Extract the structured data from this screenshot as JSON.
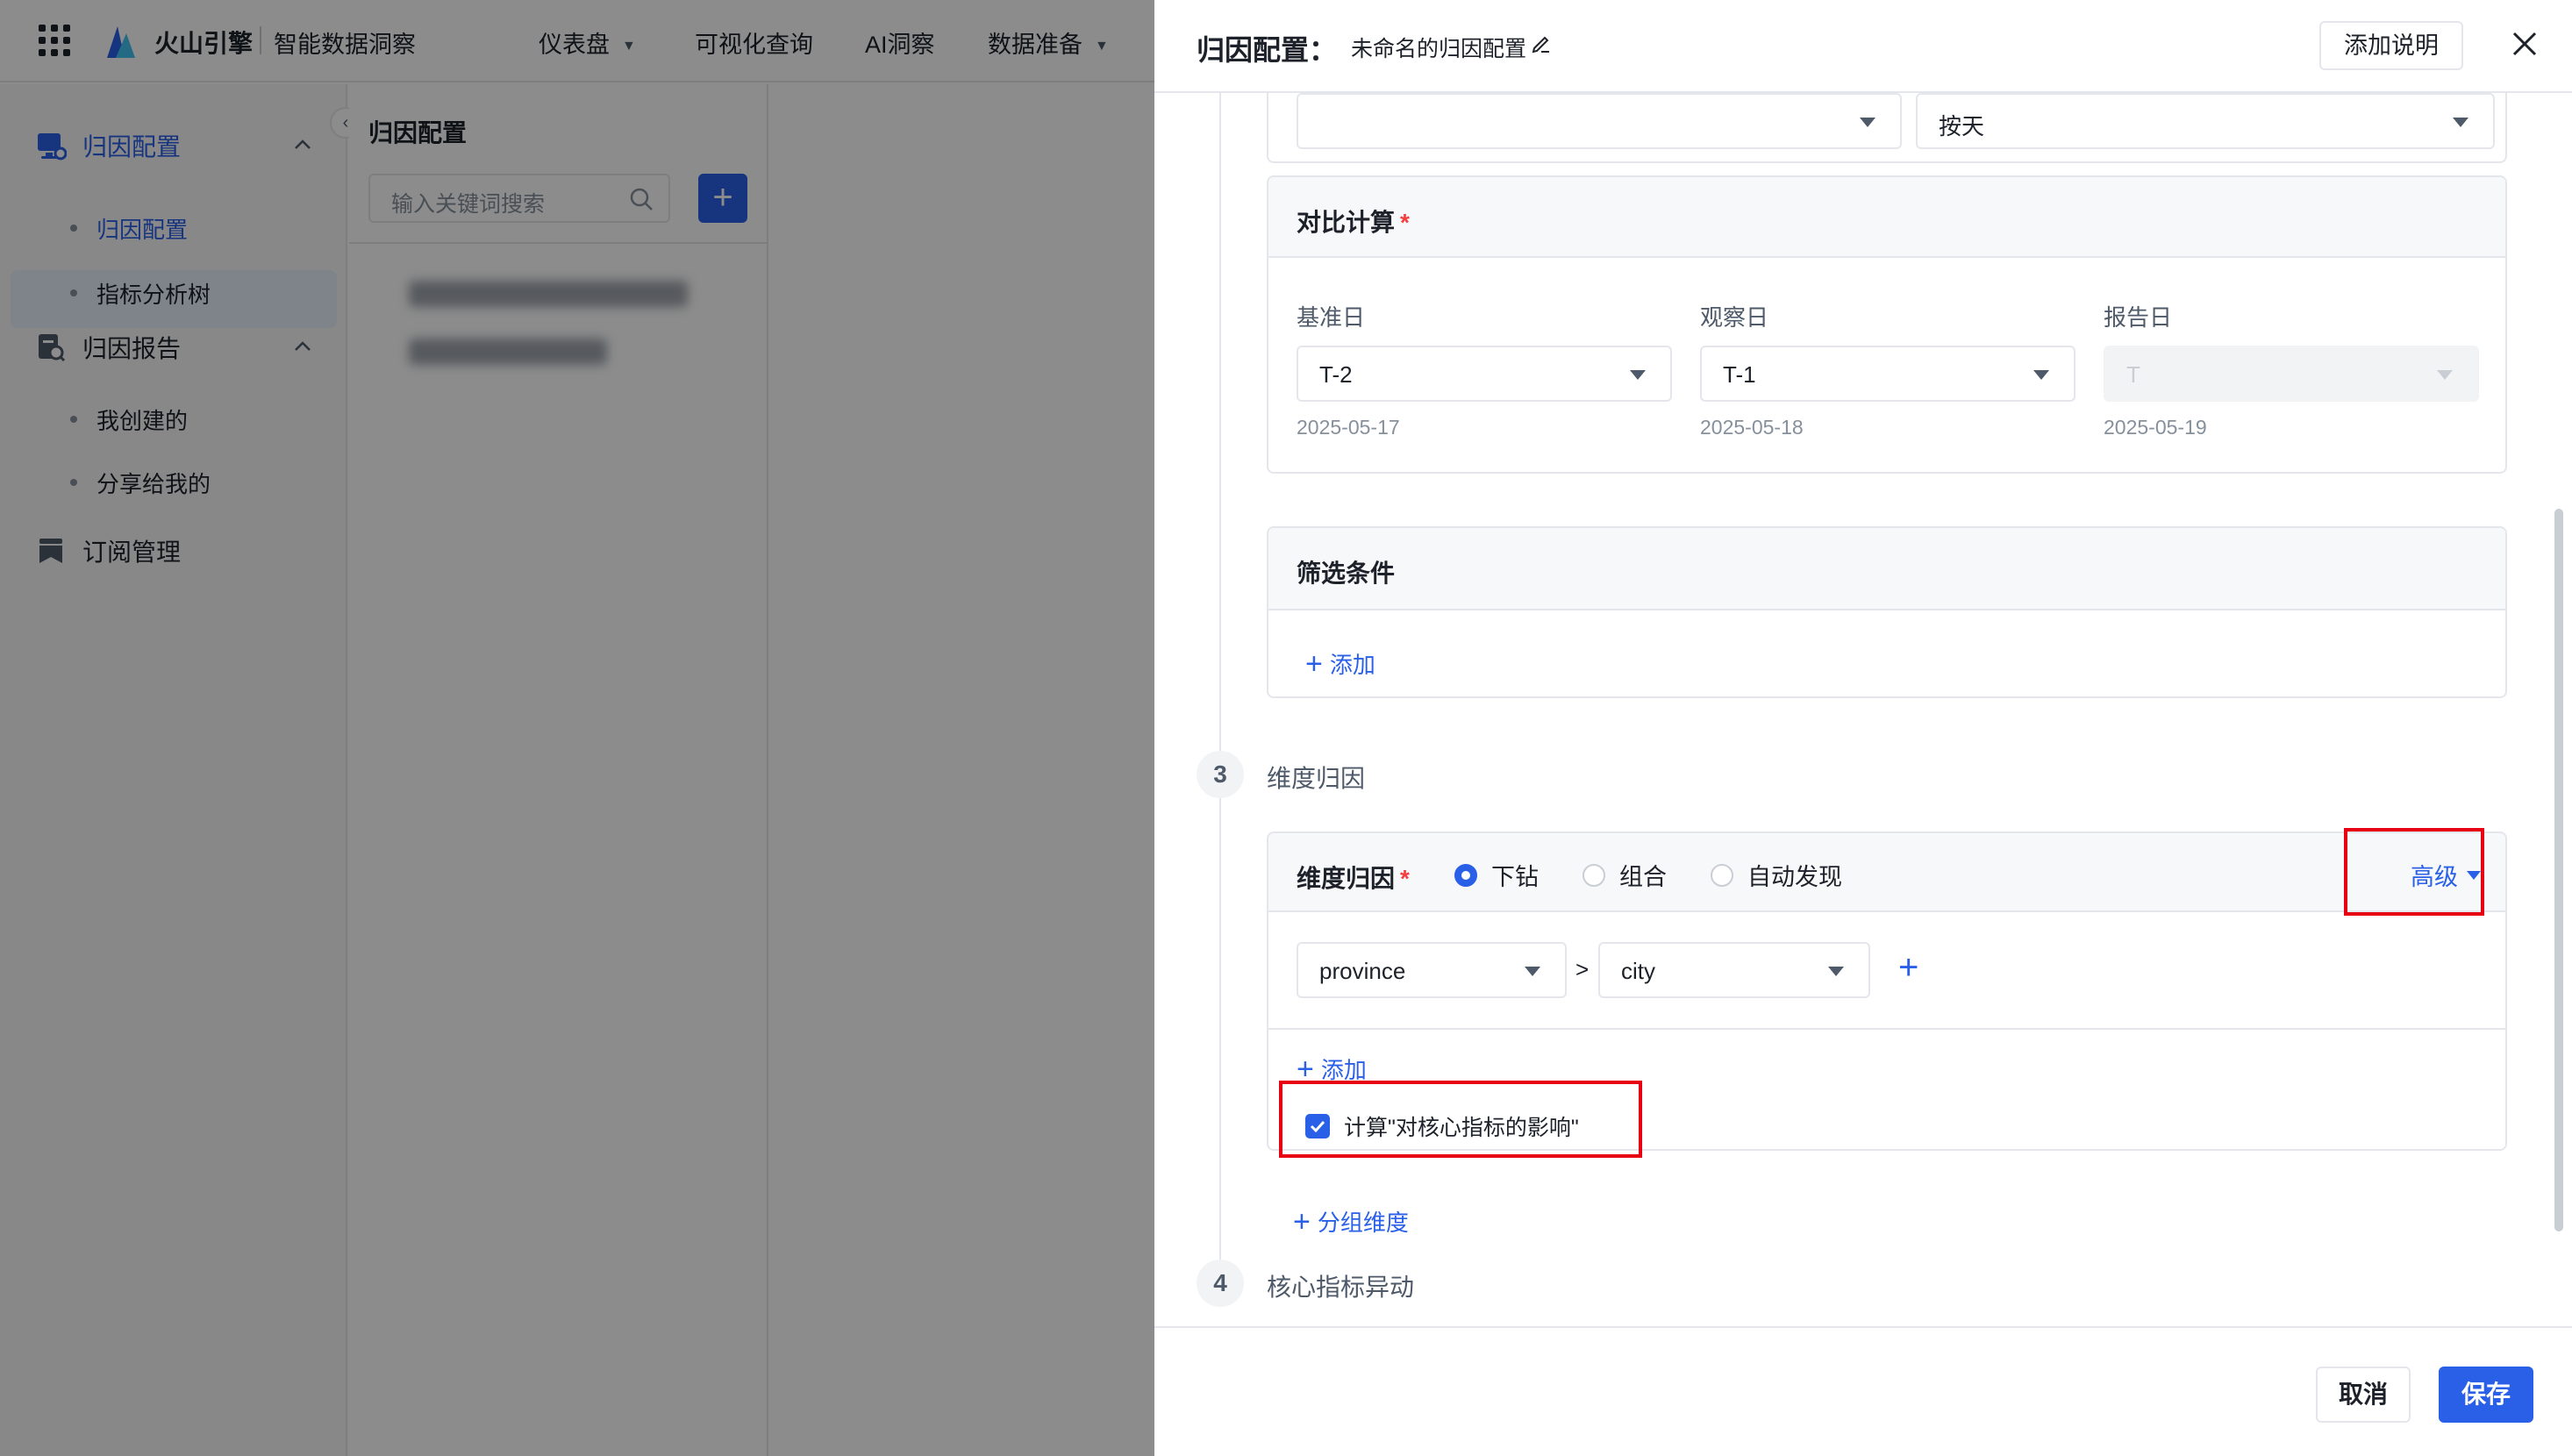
{
  "topbar": {
    "brand_name": "火山引擎",
    "brand_sub": "智能数据洞察",
    "nav": [
      {
        "label": "仪表盘",
        "has_caret": true
      },
      {
        "label": "可视化查询",
        "has_caret": false
      },
      {
        "label": "AI洞察",
        "has_caret": false
      },
      {
        "label": "数据准备",
        "has_caret": true
      }
    ]
  },
  "sidebar": {
    "groups": [
      {
        "label": "归因配置",
        "icon": "attribution-config-icon",
        "expanded": true,
        "items": [
          {
            "label": "归因配置",
            "active": true
          },
          {
            "label": "指标分析树",
            "active": false
          }
        ]
      },
      {
        "label": "归因报告",
        "icon": "attribution-report-icon",
        "expanded": true,
        "items": [
          {
            "label": "我创建的",
            "active": false
          },
          {
            "label": "分享给我的",
            "active": false
          }
        ]
      },
      {
        "label": "订阅管理",
        "icon": "subscription-icon",
        "expanded": false,
        "items": []
      }
    ]
  },
  "list_panel": {
    "title": "归因配置",
    "search_placeholder": "输入关键词搜索",
    "add_label": "+"
  },
  "drawer": {
    "title": "归因配置：",
    "config_name": "未命名的归因配置",
    "add_note_button": "添加说明",
    "top_partial": {
      "right_select_value": "按天"
    },
    "compare": {
      "title": "对比计算",
      "fields": [
        {
          "label": "基准日",
          "value": "T-2",
          "date": "2025-05-17",
          "disabled": false
        },
        {
          "label": "观察日",
          "value": "T-1",
          "date": "2025-05-18",
          "disabled": false
        },
        {
          "label": "报告日",
          "value": "T",
          "date": "2025-05-19",
          "disabled": true
        }
      ]
    },
    "filter": {
      "title": "筛选条件",
      "add_label": "添加"
    },
    "step3": {
      "number": "3",
      "label": "维度归因"
    },
    "dimension": {
      "title": "维度归因",
      "modes": [
        {
          "label": "下钻",
          "selected": true
        },
        {
          "label": "组合",
          "selected": false
        },
        {
          "label": "自动发现",
          "selected": false
        }
      ],
      "advanced_label": "高级",
      "path": [
        "province",
        "city"
      ],
      "path_separator": ">",
      "add_label": "添加",
      "checkbox_label": "计算\"对核心指标的影响\"",
      "checkbox_checked": true
    },
    "group_dim_label": "分组维度",
    "step4": {
      "number": "4",
      "label": "核心指标异动"
    },
    "footer": {
      "cancel": "取消",
      "save": "保存"
    }
  },
  "colors": {
    "primary": "#2a5fe8",
    "highlight": "#e60012",
    "required": "#f53f3f"
  }
}
